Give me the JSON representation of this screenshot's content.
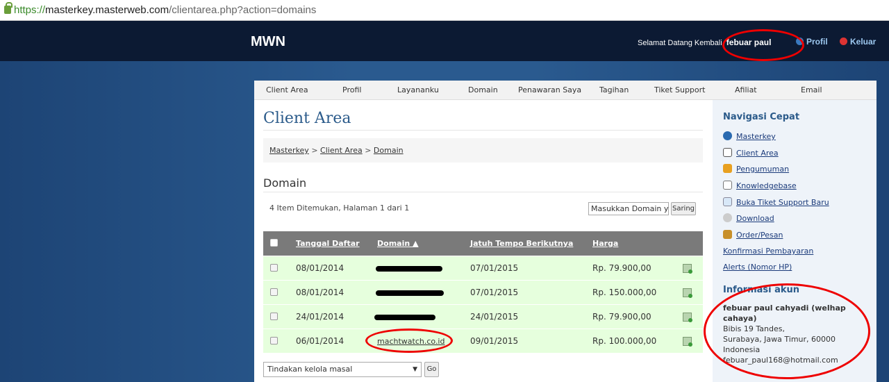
{
  "url": {
    "scheme": "https://",
    "host": "masterkey.masterweb.com",
    "path": "/clientarea.php?action=domains"
  },
  "header": {
    "logo": "MWN",
    "welcome": "Selamat Datang Kembali,",
    "user": "febuar paul",
    "profil": "Profil",
    "keluar": "Keluar"
  },
  "nav": [
    "Client Area",
    "Profil",
    "Layananku",
    "Domain",
    "Penawaran Saya",
    "Tagihan",
    "Tiket Support",
    "Afiliat",
    "Email"
  ],
  "main": {
    "title": "Client Area",
    "breadcrumb": [
      "Masterkey",
      "Client Area",
      "Domain"
    ],
    "breadcrumb_sep": ">",
    "section": "Domain",
    "count": "4 Item Ditemukan, Halaman 1 dari 1",
    "search_placeholder": "Masukkan Domain yar",
    "search_button": "Saring",
    "columns": [
      "Tanggal Daftar",
      "Domain ▲",
      "Jatuh Tempo Berikutnya",
      "Harga"
    ],
    "rows": [
      {
        "date": "08/01/2014",
        "domain": "",
        "due": "07/01/2015",
        "price": "Rp. 79.900,00"
      },
      {
        "date": "08/01/2014",
        "domain": "",
        "due": "07/01/2015",
        "price": "Rp. 150.000,00"
      },
      {
        "date": "24/01/2014",
        "domain": "",
        "due": "24/01/2015",
        "price": "Rp. 79.900,00"
      },
      {
        "date": "06/01/2014",
        "domain": "machtwatch.co.id",
        "due": "09/01/2015",
        "price": "Rp. 100.000,00"
      }
    ],
    "bulk_select": "Tindakan kelola masal",
    "go": "Go"
  },
  "sidebar": {
    "quick_nav_title": "Navigasi Cepat",
    "links": [
      "Masterkey",
      "Client Area",
      "Pengumuman",
      "Knowledgebase",
      "Buka Tiket Support Baru",
      "Download",
      "Order/Pesan",
      "Konfirmasi Pembayaran",
      "Alerts (Nomor HP)"
    ],
    "account_title": "Informasi akun",
    "name": "febuar paul cahyadi (welhap cahaya)",
    "address": [
      "Bibis 19 Tandes,",
      "Surabaya, Jawa Timur, 60000",
      "Indonesia",
      "febuar_paul168@hotmail.com"
    ]
  },
  "colors": {
    "accent": "#2a5a8a",
    "row_bg": "#e6ffdd",
    "annotation": "#e00000"
  }
}
